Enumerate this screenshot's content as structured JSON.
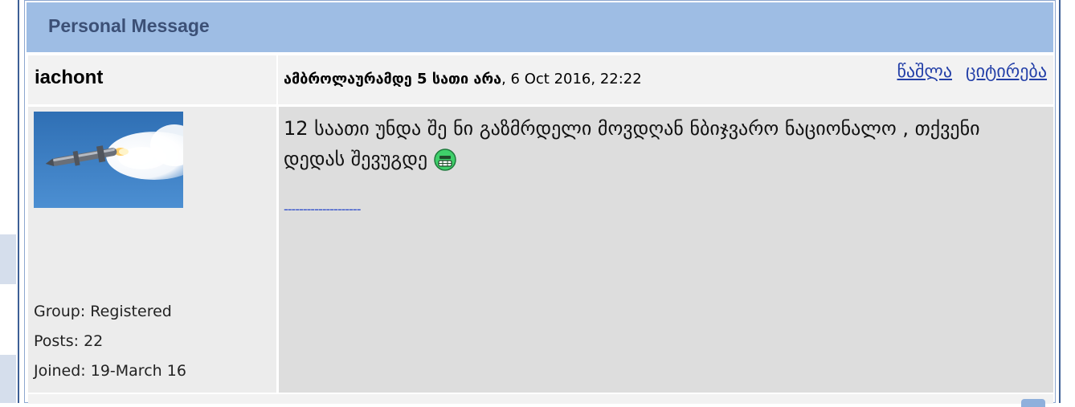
{
  "panel": {
    "title": "Personal Message"
  },
  "post": {
    "username": "iachont",
    "subject_bold": "ამბროლაურამდე 5 სათი არა",
    "date": ", 6 Oct 2016, 22:22",
    "actions": {
      "delete_label": "წაშლა",
      "quote_label": "ციტირება"
    },
    "message_text": "12 საათი უნდა შე ნი გაზმრდელი მოვდღან ნბიჯვარო ნაციონალო , თქვენი დედას შევუგდე",
    "signature_line": "--------------------",
    "avatar_icon": "missile-launch-avatar",
    "smiley_icon": "green-smiley-icon"
  },
  "user_info": {
    "group": "Group: Registered",
    "posts": "Posts: 22",
    "joined": "Joined: 19-March 16"
  },
  "colors": {
    "header_bg": "#9ebde4",
    "header_text": "#3c5076",
    "link": "#2440a8",
    "signature": "#2b49c9"
  }
}
